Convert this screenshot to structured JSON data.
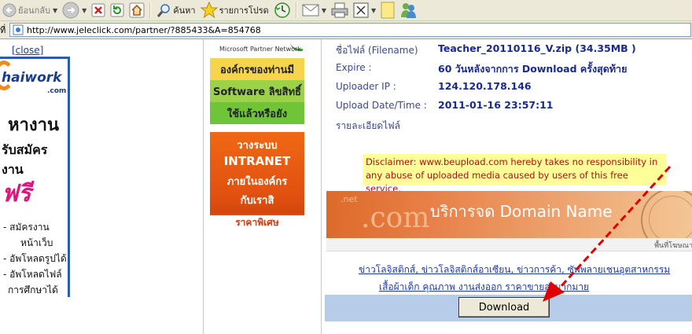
{
  "toolbar": {
    "back_label": "ย้อนกลับ",
    "search_label": "ค้นหา",
    "favorites_label": "รายการโปรด"
  },
  "address": {
    "label": "ที่",
    "url": "http://www.jeleclick.com/partner/?885433&A=854768"
  },
  "left_ad": {
    "close_label": "[close]",
    "logo_text": "haiwork",
    "logo_suffix": ".com",
    "heading1": "หางาน",
    "heading2": "รับสมัครงาน",
    "free_text": "ฟรี",
    "items": [
      "- สมัครงาน",
      "หน้าเว็บ",
      "- อัพโหลดรูปได้",
      "- อัพโหลดไฟล์",
      "การศึกษาได้"
    ]
  },
  "ms_ad": {
    "network": "Microsoft Partner Network",
    "line1": "องค์กรของท่านมี",
    "line2": "Software ลิขสิทธิ์",
    "line3": "ใช้แล้วหรือยัง"
  },
  "intranet_ad": {
    "line1": "วางระบบ",
    "line2": "INTRANET",
    "line3": "ภายในองค์กร",
    "line4": "กับเราสิ",
    "price": "ราคาพิเศษ"
  },
  "file_info": {
    "rows": [
      {
        "label": "ชื่อไฟล์ (Filename)",
        "value": "Teacher_20110116_V.zip (34.35MB )"
      },
      {
        "label": "Expire :",
        "value": "60 วันหลังจากการ Download ครั้งสุดท้าย"
      },
      {
        "label": "Uploader IP :",
        "value": "124.120.178.146"
      },
      {
        "label": "Upload Date/Time :",
        "value": "2011-01-16 23:57:11"
      },
      {
        "label": "รายละเอียดไฟล์",
        "value": ""
      }
    ]
  },
  "disclaimer": "Disclaimer: www.beupload.com hereby takes no responsibility in any abuse of uploaded media caused by users of this free service.",
  "domain_banner": {
    "small": ".net",
    "big": ".com",
    "text": "บริการจด Domain Name"
  },
  "ad_label": "พื้นที่โฆษณา",
  "links": {
    "line1": "ข่าวโลจิสติกส์, ข่าวโลจิสติกส์อาเซียน, ข่าวการค้า, ซัพพลายเชนอุตสาหกรรม",
    "line2": "เสื้อผ้าเด็ก คุณภาพ งานส่งออก ราคาขายส่งมากมาย"
  },
  "download_label": "Download",
  "colors": {
    "accent_red": "#e00000",
    "link_blue": "#1d3ba7",
    "download_bar": "#b7cce8"
  }
}
